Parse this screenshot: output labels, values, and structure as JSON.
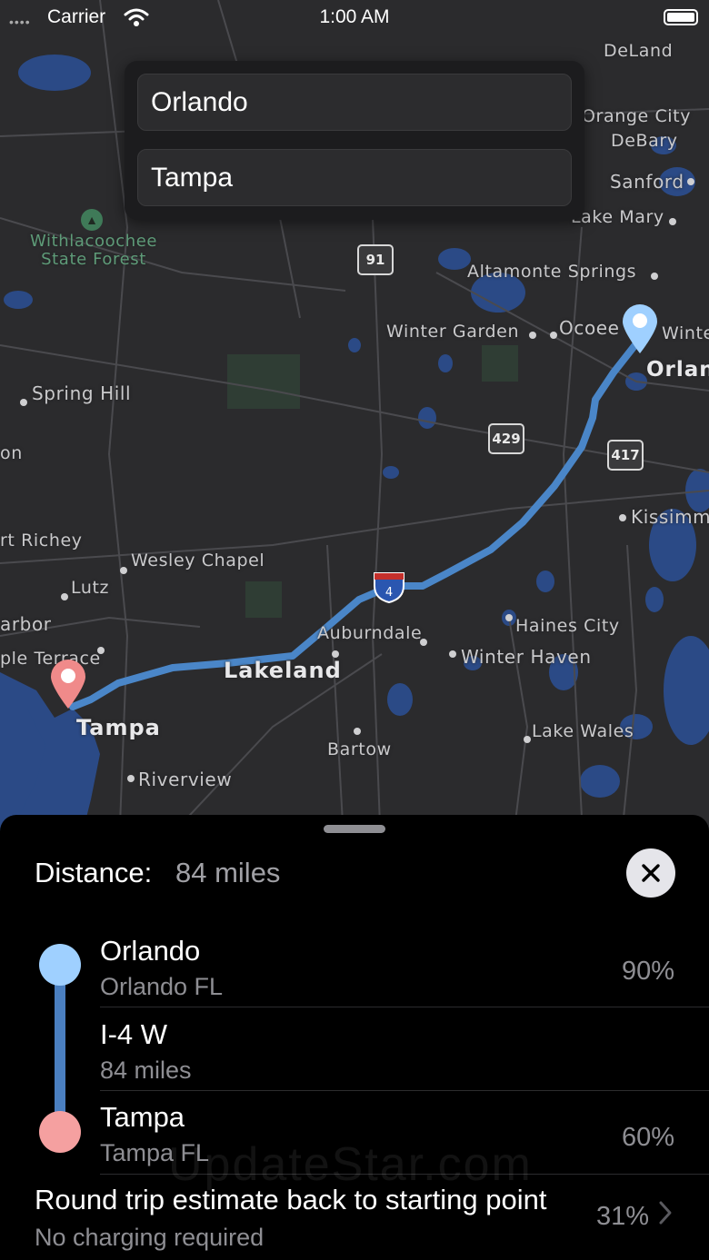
{
  "status_bar": {
    "carrier": "Carrier",
    "signal": "••••",
    "time": "1:00 AM"
  },
  "search": {
    "origin_value": "Orlando",
    "destination_value": "Tampa"
  },
  "map": {
    "labels": {
      "deland": "DeLand",
      "orange_city": "Orange City",
      "debary": "DeBary",
      "sanford": "Sanford",
      "lake_mary": "Lake Mary",
      "withlacoochee": "Withlacoochee",
      "state_forest": "State Forest",
      "altamonte_springs": "Altamonte Springs",
      "winter_garden": "Winter Garden",
      "ocoee": "Ocoee",
      "winter_park": "Winte",
      "orlando": "Orlan",
      "spring_hill": "Spring Hill",
      "hudson": "on",
      "port_richey": "rt Richey",
      "wesley_chapel": "Wesley Chapel",
      "lutz": "Lutz",
      "harbor": "arbor",
      "palm_terrace": "ple Terrace",
      "kissimmee": "Kissimm",
      "haines_city": "Haines City",
      "winter_haven": "Winter Haven",
      "auburndale": "Auburndale",
      "lakeland": "Lakeland",
      "tampa": "Tampa",
      "bartow": "Bartow",
      "lake_wales": "Lake Wales",
      "riverview": "Riverview"
    },
    "shields": {
      "sr91": "91",
      "sr429": "429",
      "sr417": "417",
      "i4": "4"
    },
    "colors": {
      "route": "#4a86c8",
      "origin_pin": "#9fd0ff",
      "destination_pin": "#f08a8a",
      "water": "#2b4a86",
      "land": "#2b2b2d"
    }
  },
  "sheet": {
    "distance_label": "Distance:",
    "distance_value": "84 miles",
    "steps": [
      {
        "title": "Orlando",
        "subtitle": "Orlando FL",
        "percent": "90%"
      },
      {
        "title": "I-4 W",
        "subtitle": "84 miles",
        "percent": ""
      },
      {
        "title": "Tampa",
        "subtitle": "Tampa FL",
        "percent": "60%"
      }
    ],
    "round_trip": {
      "title": "Round trip estimate back to starting point",
      "subtitle": "No charging required",
      "percent": "31%"
    },
    "watermark": "UpdateStar.com"
  }
}
